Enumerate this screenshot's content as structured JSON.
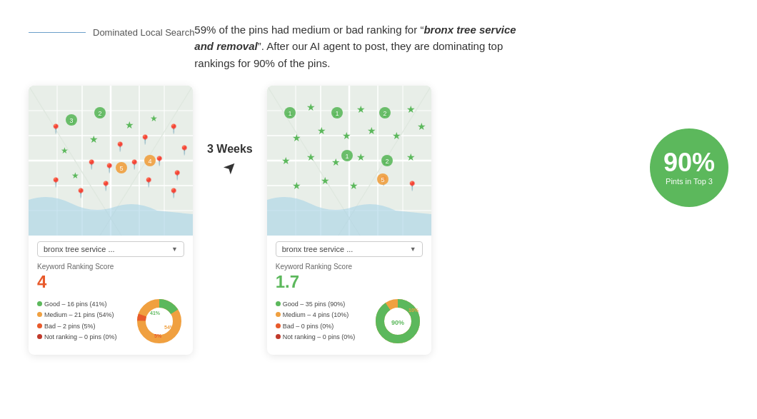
{
  "header": {
    "line_label": "Dominated Local Search",
    "description_part1": "59% of the pins had medium or bad ranking for “",
    "description_keyword": "bronx tree service and removal",
    "description_part2": "”. After our AI agent to post, they are dominating top rankings for 90% of the pins."
  },
  "arrow": {
    "label": "3 Weeks",
    "icon": "➞"
  },
  "before_card": {
    "dropdown_text": "bronx tree service ...",
    "keyword_score_label": "Keyword Ranking Score",
    "score": "4",
    "stats": [
      {
        "color": "green",
        "text": "Good – 16 pins (41%)"
      },
      {
        "color": "orange",
        "text": "Medium – 21 pins (54%)"
      },
      {
        "color": "red",
        "text": "Bad – 2 pins (5%)"
      },
      {
        "color": "darkred",
        "text": "Not ranking – 0 pins (0%)"
      }
    ],
    "donut": {
      "segments": [
        {
          "value": 41,
          "color": "#5cb85c",
          "label": "41%"
        },
        {
          "value": 54,
          "color": "#f0a040",
          "label": "54%"
        },
        {
          "value": 5,
          "color": "#e85a2b",
          "label": "5%"
        }
      ]
    }
  },
  "after_card": {
    "dropdown_text": "bronx tree service ...",
    "keyword_score_label": "Keyword Ranking Score",
    "score": "1.7",
    "stats": [
      {
        "color": "green",
        "text": "Good – 35 pins (90%)"
      },
      {
        "color": "orange",
        "text": "Medium – 4 pins (10%)"
      },
      {
        "color": "red",
        "text": "Bad – 0 pins (0%)"
      },
      {
        "color": "darkred",
        "text": "Not ranking – 0 pins (0%)"
      }
    ],
    "donut": {
      "segments": [
        {
          "value": 90,
          "color": "#5cb85c",
          "label": "90%"
        },
        {
          "value": 10,
          "color": "#f0a040",
          "label": "10%"
        }
      ]
    }
  },
  "badge": {
    "percent": "90%",
    "label": "Pints in Top 3"
  }
}
